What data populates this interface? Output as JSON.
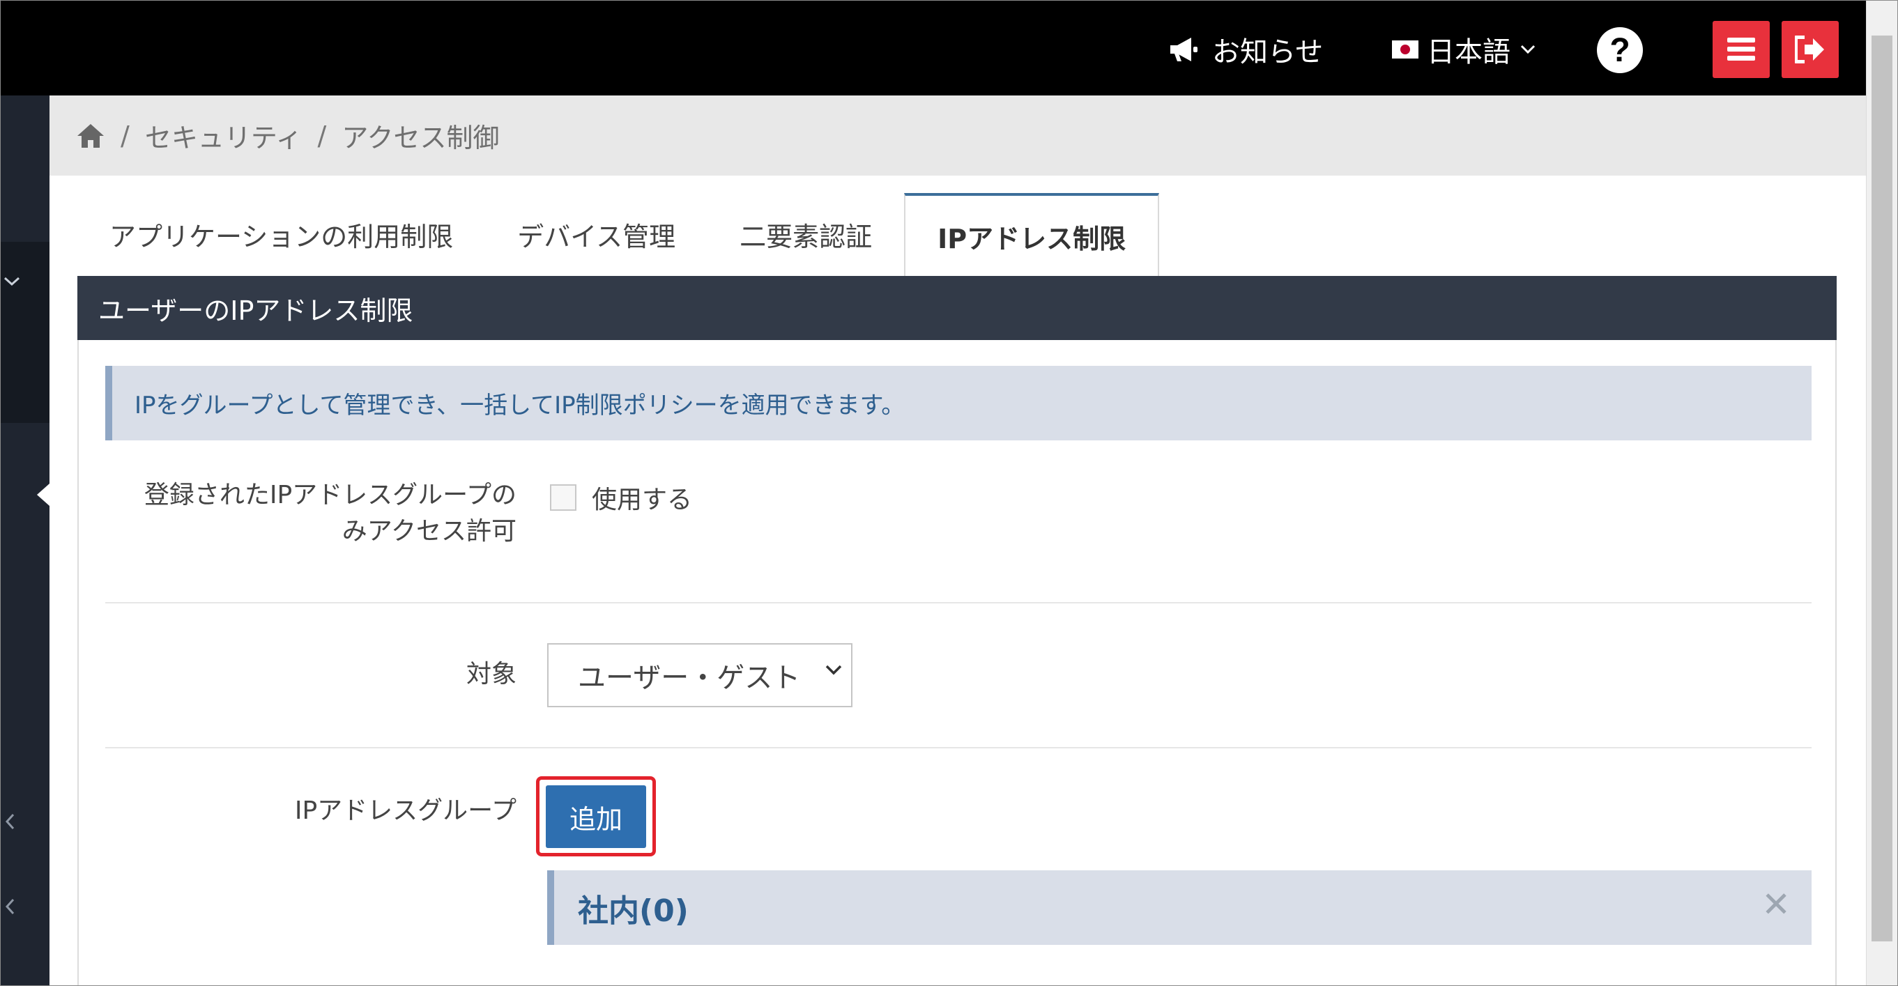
{
  "topbar": {
    "notice_label": "お知らせ",
    "language_label": "日本語",
    "help_symbol": "?"
  },
  "breadcrumb": {
    "items": [
      "セキュリティ",
      "アクセス制御"
    ],
    "separator": "/"
  },
  "tabs": [
    {
      "label": "アプリケーションの利用制限",
      "active": false
    },
    {
      "label": "デバイス管理",
      "active": false
    },
    {
      "label": "二要素認証",
      "active": false
    },
    {
      "label": "IPアドレス制限",
      "active": true
    }
  ],
  "panel": {
    "title": "ユーザーのIPアドレス制限",
    "info": "IPをグループとして管理でき、一括してIP制限ポリシーを適用できます。",
    "restrict_label_line1": "登録されたIPアドレスグループの",
    "restrict_label_line2": "みアクセス許可",
    "use_checkbox_label": "使用する",
    "use_checked": false,
    "target_label": "対象",
    "target_value": "ユーザー・ゲスト",
    "ip_group_label": "IPアドレスグループ",
    "add_button": "追加",
    "groups": [
      {
        "name": "社内(0)"
      }
    ],
    "close_symbol": "✕"
  },
  "colors": {
    "topbar_bg": "#000000",
    "accent_red": "#e8313c",
    "header_bg": "#323a48",
    "primary_button": "#2e6fb0",
    "info_bg": "#d9dee8",
    "info_text": "#2e5f8f",
    "highlight": "#e3232c"
  }
}
